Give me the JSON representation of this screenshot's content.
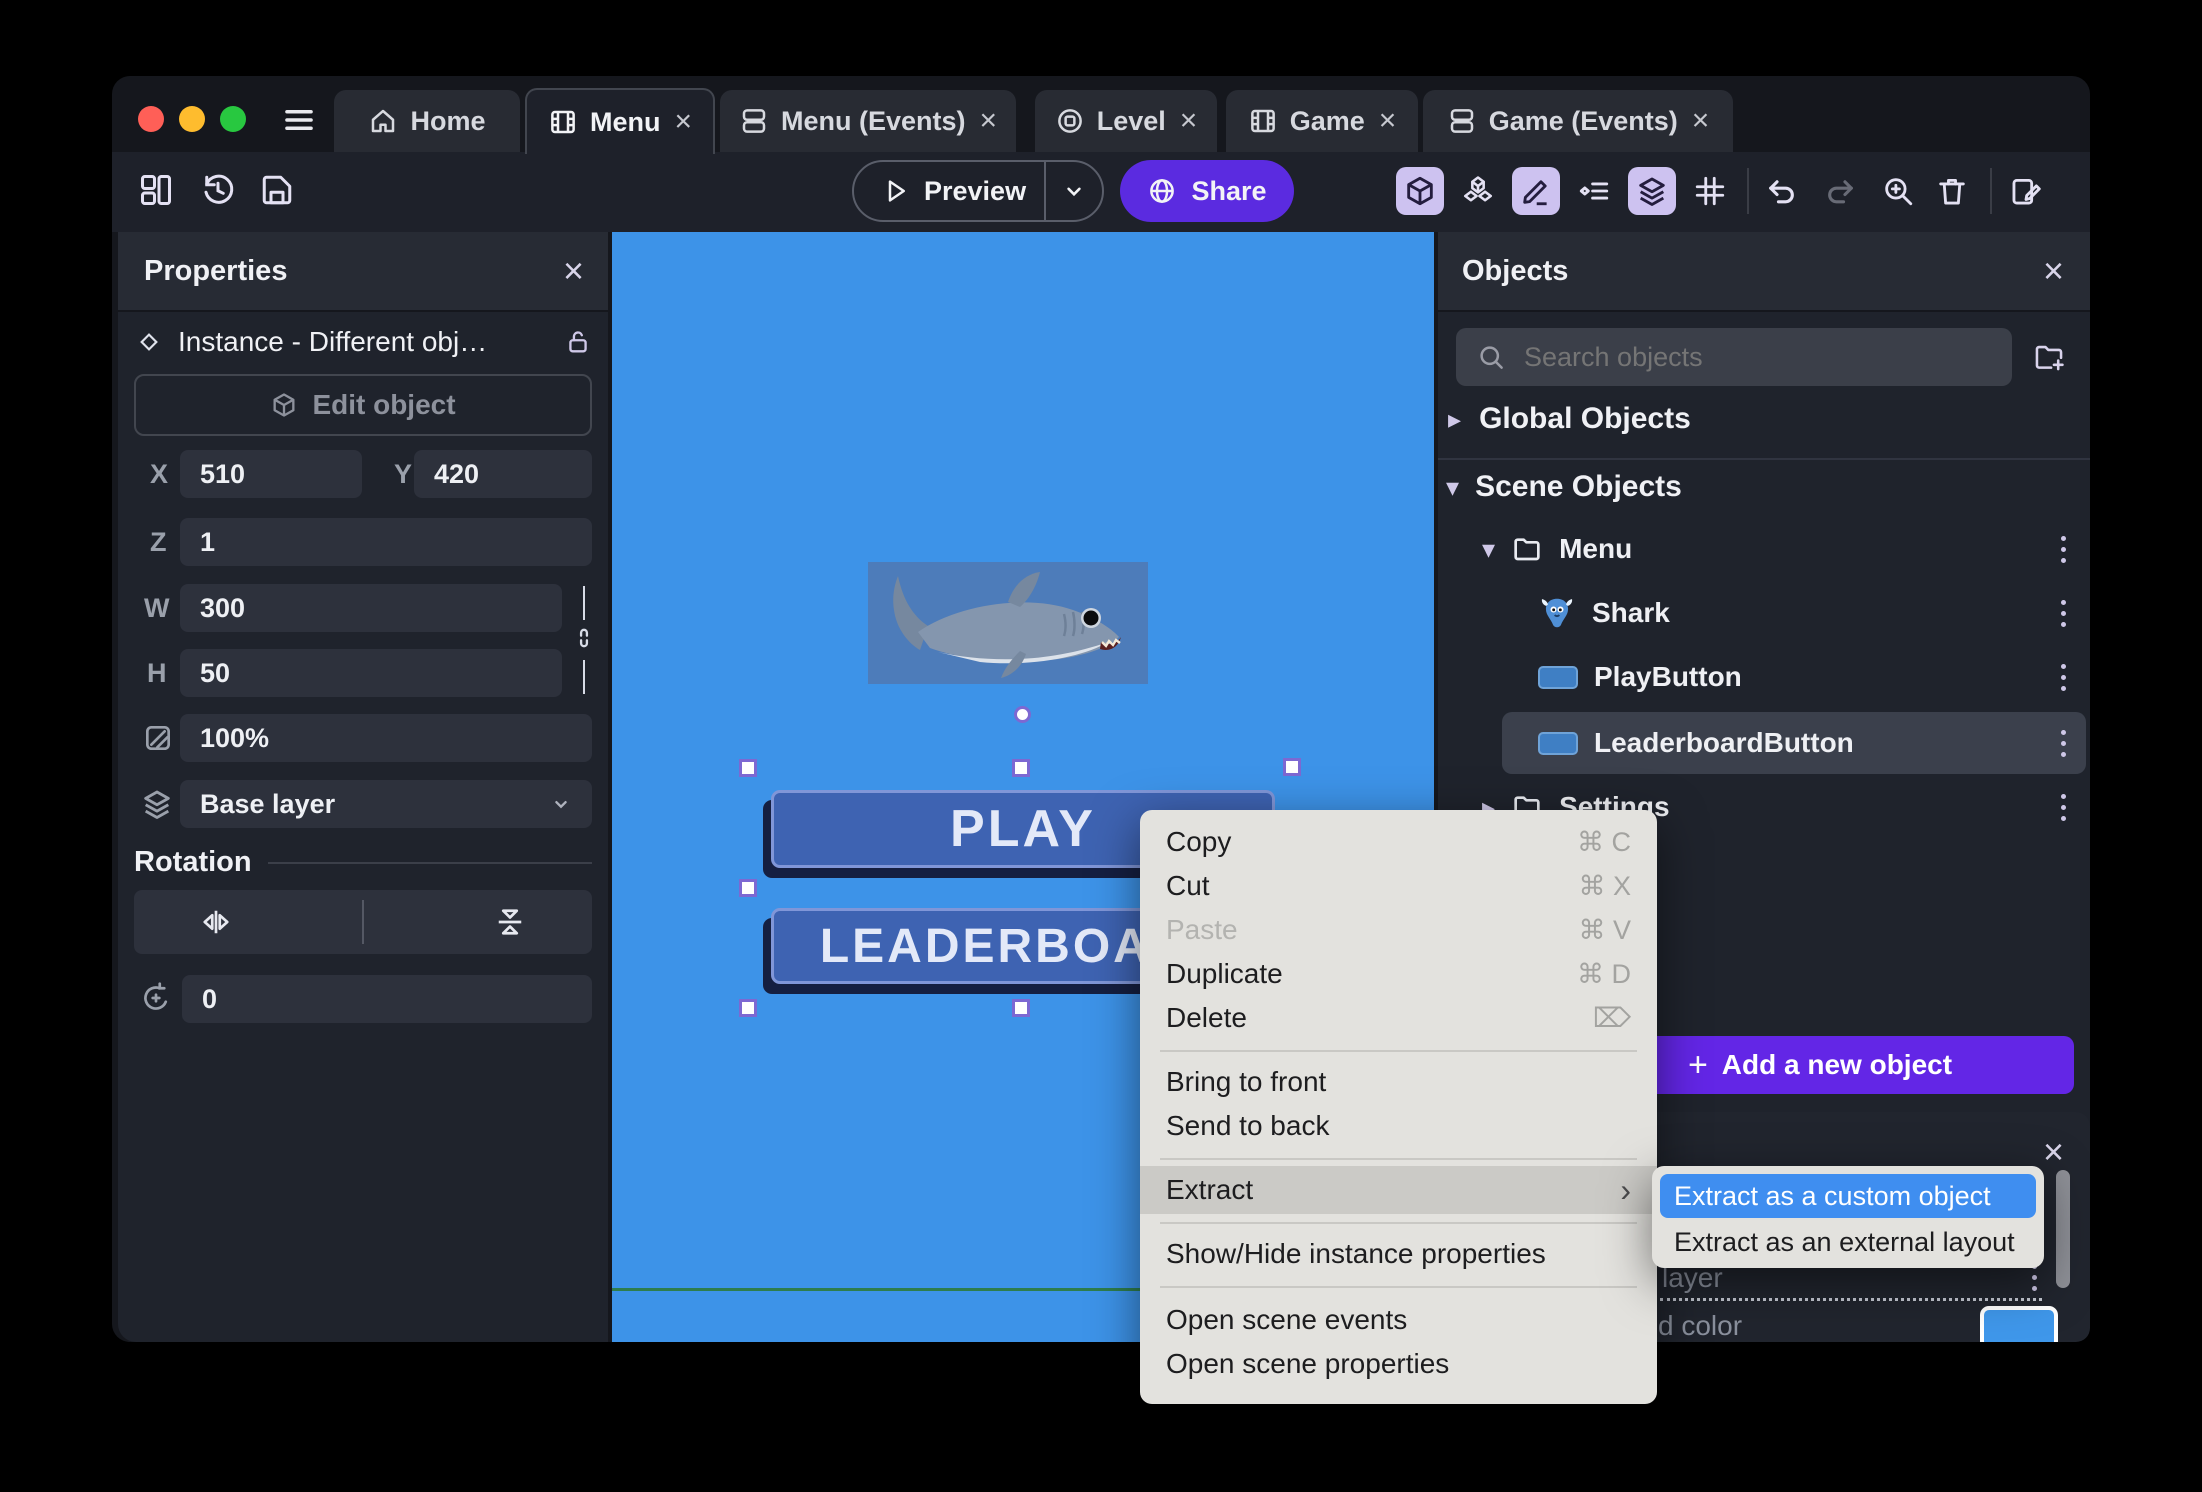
{
  "colors": {
    "canvas_blue": "#3d93e8",
    "shark_box_blue": "#4d7cba",
    "share_purple": "#5b2be0",
    "add_button_purple": "#6326e6",
    "submenu_highlight_blue": "#3f8ef0",
    "background_color_swatch": "#3f97ea",
    "selection_handle_border": "#7d68d2",
    "scene_guide_green": "#2e7d4d"
  },
  "titlebar": {
    "tabs": [
      {
        "label": "Home",
        "close": ""
      },
      {
        "label": "Menu",
        "close": "×"
      },
      {
        "label": "Menu (Events)",
        "close": "×"
      },
      {
        "label": "Level",
        "close": "×"
      },
      {
        "label": "Game",
        "close": "×"
      },
      {
        "label": "Game (Events)",
        "close": "×"
      }
    ]
  },
  "toolbar": {
    "preview_label": "Preview",
    "share_label": "Share"
  },
  "properties_panel": {
    "title": "Properties",
    "close": "×",
    "instance_label": "Instance  -  Different obj…",
    "edit_object_label": "Edit object",
    "x_label": "X",
    "x_value": "510",
    "y_label": "Y",
    "y_value": "420",
    "z_label": "Z",
    "z_value": "1",
    "w_label": "W",
    "w_value": "300",
    "h_label": "H",
    "h_value": "50",
    "opacity_value": "100%",
    "layer_value": "Base layer",
    "rotation_title": "Rotation",
    "angle_value": "0"
  },
  "canvas": {
    "play_button_label": "PLAY",
    "leaderboard_button_label": "LEADERBOARD"
  },
  "context_menu": {
    "items": [
      {
        "label": "Copy",
        "shortcut": "⌘ C"
      },
      {
        "label": "Cut",
        "shortcut": "⌘ X"
      },
      {
        "label": "Paste",
        "shortcut": "⌘ V"
      },
      {
        "label": "Duplicate",
        "shortcut": "⌘ D"
      },
      {
        "label": "Delete",
        "shortcut": "⌦"
      },
      {
        "label": "Bring to front",
        "shortcut": ""
      },
      {
        "label": "Send to back",
        "shortcut": ""
      },
      {
        "label": "Extract",
        "shortcut": "›"
      },
      {
        "label": "Show/Hide instance properties",
        "shortcut": ""
      },
      {
        "label": "Open scene events",
        "shortcut": ""
      },
      {
        "label": "Open scene properties",
        "shortcut": ""
      }
    ]
  },
  "extract_submenu": {
    "items": [
      {
        "label": "Extract as a custom object"
      },
      {
        "label": "Extract as an external layout"
      }
    ]
  },
  "objects_panel": {
    "title": "Objects",
    "close": "×",
    "search_placeholder": "Search objects",
    "global_section": "Global Objects",
    "scene_section": "Scene Objects",
    "tree": [
      {
        "label": "Menu"
      },
      {
        "label": "Shark"
      },
      {
        "label": "PlayButton"
      },
      {
        "label": "LeaderboardButton"
      },
      {
        "label": "Settings"
      }
    ],
    "add_button_plus": "+",
    "add_button_label": "Add a new object"
  },
  "detail_panel": {
    "close": "×",
    "layer_text_fragment": "layer",
    "color_text_fragment": "d color"
  }
}
